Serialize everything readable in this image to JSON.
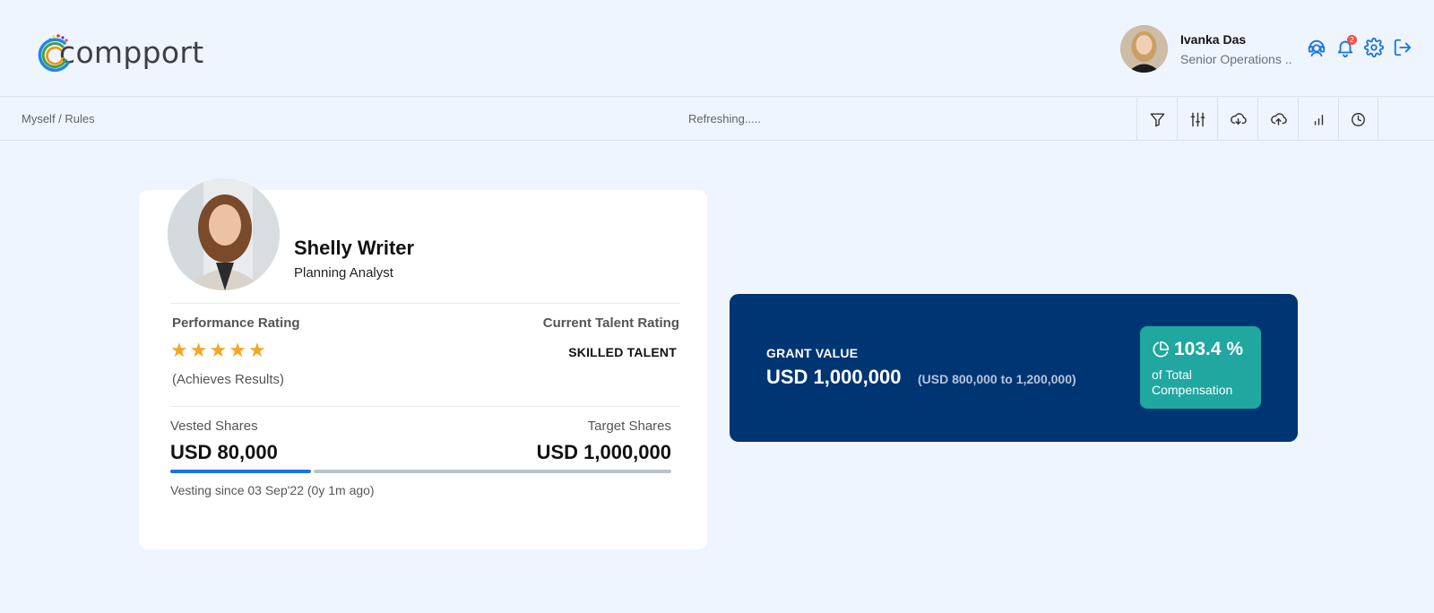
{
  "header": {
    "logo_text": "compport",
    "user": {
      "name": "Ivanka Das",
      "role": "Senior Operations .."
    },
    "icons": [
      "support-agent-icon",
      "bell-icon",
      "gear-icon",
      "logout-icon"
    ],
    "notification_count": "2"
  },
  "subbar": {
    "breadcrumb": "Myself / Rules",
    "status": "Refreshing.....",
    "toolbar_icons": [
      "filter-icon",
      "sliders-icon",
      "download-cloud-icon",
      "upload-cloud-icon",
      "bar-chart-icon",
      "clock-icon"
    ]
  },
  "profile": {
    "name": "Shelly Writer",
    "title": "Planning Analyst",
    "performance_label": "Performance Rating",
    "performance_stars": 5,
    "performance_text": "(Achieves Results)",
    "talent_label": "Current Talent Rating",
    "talent_value": "SKILLED TALENT",
    "vested_label": "Vested Shares",
    "vested_value": "USD 80,000",
    "target_label": "Target Shares",
    "target_value": "USD 1,000,000",
    "vesting_progress_fraction": 0.28,
    "vesting_since": "Vesting since 03 Sep'22 (0y 1m ago)"
  },
  "grant": {
    "label": "GRANT VALUE",
    "value": "USD 1,000,000",
    "range": "(USD 800,000 to 1,200,000)",
    "percent": "103.4 %",
    "percent_caption": "of Total Compensation"
  },
  "colors": {
    "accent": "#1a73e8",
    "grant_bg": "#003574",
    "percent_bg": "#1fa7a0",
    "star": "#f5a623",
    "page_bg": "#eef5fe"
  }
}
